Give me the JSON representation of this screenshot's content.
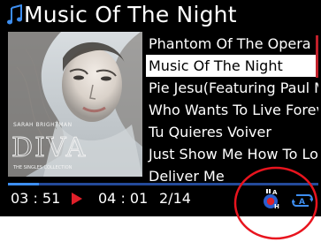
{
  "title": "Music Of The Night",
  "album_art": {
    "artist": "SARAH BRIGHTMAN",
    "album": "DIVA",
    "subtitle": "THE SINGLES COLLECTION"
  },
  "tracks": [
    {
      "label": "Phantom Of The Opera",
      "selected": false
    },
    {
      "label": "Music Of The Night",
      "selected": true
    },
    {
      "label": "Pie Jesu(Featuring Paul M..",
      "selected": false
    },
    {
      "label": "Who Wants To Live Forev..",
      "selected": false
    },
    {
      "label": "Tu Quieres Voiver",
      "selected": false
    },
    {
      "label": "Just Show Me How To Lo..",
      "selected": false
    },
    {
      "label": "Deliver Me",
      "selected": false
    }
  ],
  "playback": {
    "elapsed": "03 : 51",
    "total": "04 : 01",
    "track_position": "2/14",
    "progress": 0.1
  },
  "icons": {
    "title": "music-note-icon",
    "play": "play-icon",
    "mode_a": "repeat-a-icon",
    "mode_b": "repeat-ab-icon"
  },
  "colors": {
    "background": "#000000",
    "selection": "#ffffff",
    "accent_red": "#e0202a",
    "accent_blue": "#3d8ef0",
    "annotation": "#e8141e"
  }
}
